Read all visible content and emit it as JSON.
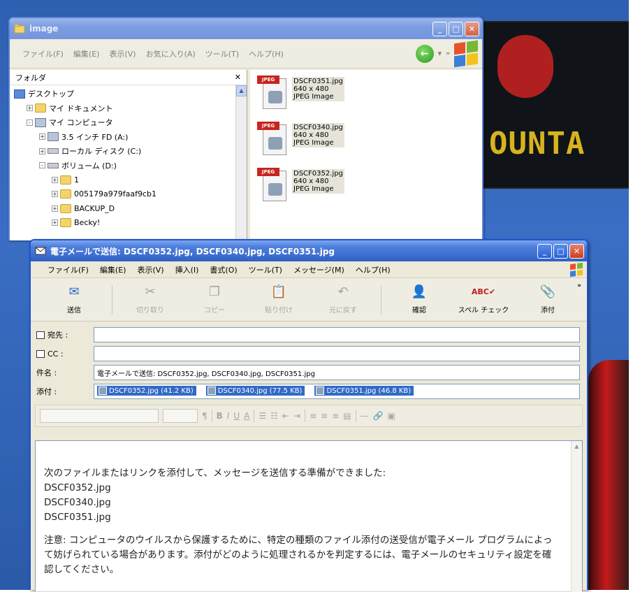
{
  "explorer": {
    "title": "image",
    "menu": [
      "ファイル(F)",
      "編集(E)",
      "表示(V)",
      "お気に入り(A)",
      "ツール(T)",
      "ヘルプ(H)"
    ],
    "folders_title": "フォルダ",
    "tree": [
      {
        "label": "デスクトップ",
        "level": 0,
        "icon": "desktop-icon",
        "exp": ""
      },
      {
        "label": "マイ ドキュメント",
        "level": 1,
        "icon": "folder-icon",
        "exp": "+"
      },
      {
        "label": "マイ コンピュータ",
        "level": 1,
        "icon": "computer-icon",
        "exp": "-"
      },
      {
        "label": "3.5 インチ FD (A:)",
        "level": 2,
        "icon": "floppy-icon",
        "exp": "+"
      },
      {
        "label": "ローカル ディスク (C:)",
        "level": 2,
        "icon": "drive-icon",
        "exp": "+"
      },
      {
        "label": "ボリューム (D:)",
        "level": 2,
        "icon": "drive-icon",
        "exp": "-"
      },
      {
        "label": "1",
        "level": 3,
        "icon": "folder-icon",
        "exp": "+"
      },
      {
        "label": "005179a979faaf9cb1",
        "level": 3,
        "icon": "folder-icon",
        "exp": "+"
      },
      {
        "label": "BACKUP_D",
        "level": 3,
        "icon": "folder-icon",
        "exp": "+"
      },
      {
        "label": "Becky!",
        "level": 3,
        "icon": "folder-icon",
        "exp": "+"
      }
    ],
    "files": [
      {
        "name": "DSCF0351.jpg",
        "dims": "640 x 480",
        "type": "JPEG Image"
      },
      {
        "name": "DSCF0340.jpg",
        "dims": "640 x 480",
        "type": "JPEG Image"
      },
      {
        "name": "DSCF0352.jpg",
        "dims": "640 x 480",
        "type": "JPEG Image"
      }
    ]
  },
  "compose": {
    "title": "電子メールで送信: DSCF0352.jpg, DSCF0340.jpg, DSCF0351.jpg",
    "menu": [
      "ファイル(F)",
      "編集(E)",
      "表示(V)",
      "挿入(I)",
      "書式(O)",
      "ツール(T)",
      "メッセージ(M)",
      "ヘルプ(H)"
    ],
    "toolbar": [
      {
        "label": "送信",
        "icon": "send-icon",
        "glyph": "✉",
        "enabled": true
      },
      {
        "label": "切り取り",
        "icon": "cut-icon",
        "glyph": "✂",
        "enabled": false
      },
      {
        "label": "コピー",
        "icon": "copy-icon",
        "glyph": "❐",
        "enabled": false
      },
      {
        "label": "貼り付け",
        "icon": "paste-icon",
        "glyph": "📋",
        "enabled": false
      },
      {
        "label": "元に戻す",
        "icon": "undo-icon",
        "glyph": "↶",
        "enabled": false
      },
      {
        "label": "確認",
        "icon": "check-names-icon",
        "glyph": "👤",
        "enabled": true
      },
      {
        "label": "スペル チェック",
        "icon": "spellcheck-icon",
        "glyph": "ABC✔",
        "enabled": true
      },
      {
        "label": "添付",
        "icon": "paperclip-icon",
        "glyph": "📎",
        "enabled": true
      }
    ],
    "fields": {
      "to_label": "宛先 :",
      "to_value": "",
      "cc_label": "CC :",
      "cc_value": "",
      "subject_label": "件名 :",
      "subject_value": "電子メールで送信: DSCF0352.jpg, DSCF0340.jpg, DSCF0351.jpg",
      "attach_label": "添付 :",
      "attachments": [
        "DSCF0352.jpg (41.2 KB)",
        "DSCF0340.jpg (77.5 KB)",
        "DSCF0351.jpg (46.8 KB)"
      ]
    },
    "body": {
      "line1": "次のファイルまたはリンクを添付して、メッセージを送信する準備ができました:",
      "file1": "DSCF0352.jpg",
      "file2": "DSCF0340.jpg",
      "file3": "DSCF0351.jpg",
      "notice": "注意: コンピュータのウイルスから保護するために、特定の種類のファイル添付の送受信が電子メール プログラムによって妨げられている場合があります。添付がどのように処理されるかを判定するには、電子メールのセキュリティ設定を確認してください。"
    }
  },
  "wallpaper": {
    "banner_text": "OUNTA"
  },
  "colors": {
    "xp_blue": "#1f54cf",
    "selection": "#316ac5",
    "close_red": "#c9401c"
  }
}
